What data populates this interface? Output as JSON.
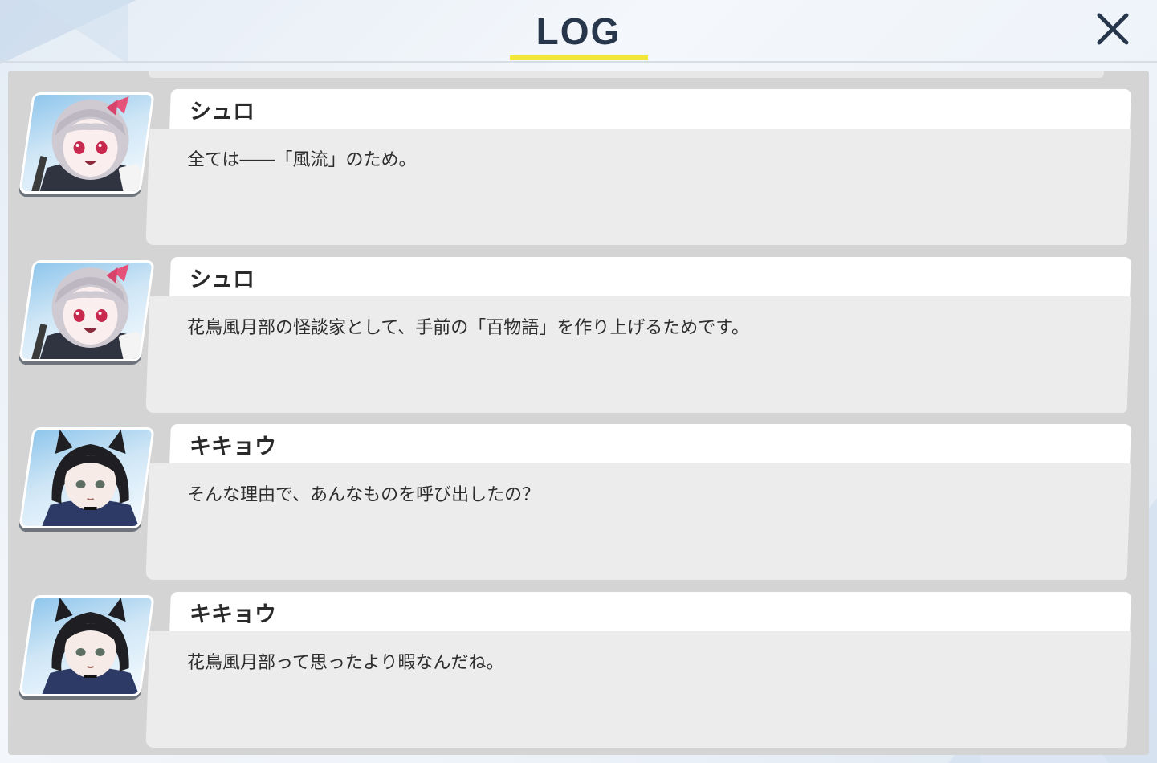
{
  "header": {
    "title": "LOG",
    "close_icon": "close-icon",
    "accent_color": "#f3e53a"
  },
  "log": {
    "entries": [
      {
        "speaker": "シュロ",
        "message": "全ては――「風流」のため。",
        "avatar": "shuro-portrait"
      },
      {
        "speaker": "シュロ",
        "message": "花鳥風月部の怪談家として、手前の「百物語」を作り上げるためです。",
        "avatar": "shuro-portrait"
      },
      {
        "speaker": "キキョウ",
        "message": "そんな理由で、あんなものを呼び出したの？",
        "avatar": "kikyou-portrait"
      },
      {
        "speaker": "キキョウ",
        "message": "花鳥風月部って思ったより暇なんだね。",
        "avatar": "kikyou-portrait"
      }
    ]
  }
}
